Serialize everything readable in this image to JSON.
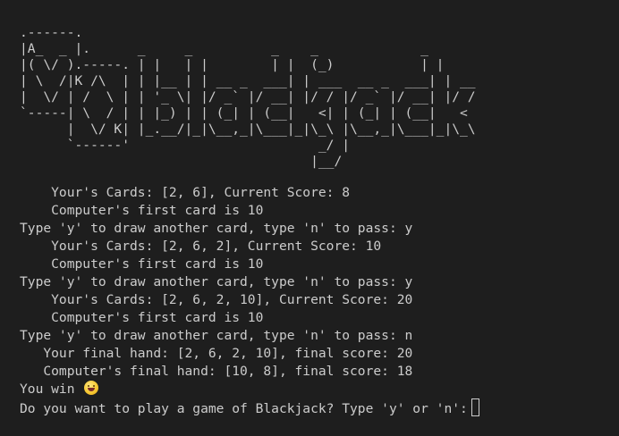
{
  "logo_art": ".------.                                 \n|A_  _ |.      _     _          _    _             _\n|( \\/ ).-----. | |   | |        | |  (_)           | |\n| \\  /|K /\\  | | |__ | | __ _  ___| | ___  __ _  ___| | __\n|  \\/ | /  \\ | | '_ \\| |/ _` |/ __| |/ / |/ _` |/ __| |/ /\n`-----| \\  / | | |_) | | (_| | (__|   <| | (_| | (__|   <\n      |  \\/ K| |_.__/|_|\\__,_|\\___|_|\\_\\ |\\__,_|\\___|_|\\_\\\n      `------'                        _/ |\n                                     |__/",
  "lines": [
    "    Your's Cards: [2, 6], Current Score: 8",
    "    Computer's first card is 10",
    "Type 'y' to draw another card, type 'n' to pass: y",
    "    Your's Cards: [2, 6, 2], Current Score: 10",
    "    Computer's first card is 10",
    "Type 'y' to draw another card, type 'n' to pass: y",
    "    Your's Cards: [2, 6, 2, 10], Current Score: 20",
    "    Computer's first card is 10",
    "Type 'y' to draw another card, type 'n' to pass: n",
    "   Your final hand: [2, 6, 2, 10], final score: 20",
    "   Computer's final hand: [10, 8], final score: 18"
  ],
  "win_text": "You win ",
  "emoji_icon": "grinning-face-emoji",
  "prompt_text": "Do you want to play a game of Blackjack? Type 'y' or 'n':",
  "colors": {
    "background": "#1e1e1e",
    "foreground": "#cccccc"
  }
}
